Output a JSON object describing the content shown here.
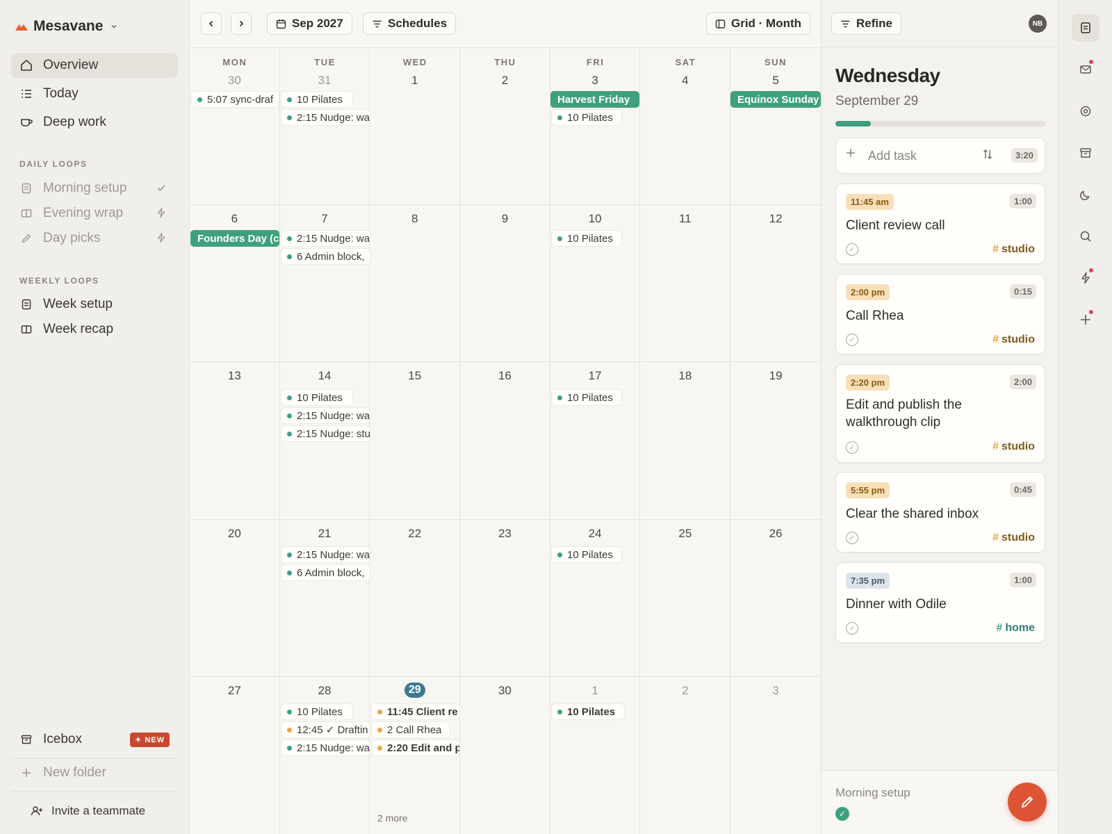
{
  "workspace": {
    "name": "Mesavane"
  },
  "nav": [
    {
      "label": "Overview"
    },
    {
      "label": "Today"
    },
    {
      "label": "Deep work"
    }
  ],
  "daily_loops": {
    "heading": "DAILY LOOPS",
    "items": [
      {
        "label": "Morning setup"
      },
      {
        "label": "Evening wrap"
      },
      {
        "label": "Day picks"
      }
    ]
  },
  "weekly_loops": {
    "heading": "WEEKLY LOOPS",
    "items": [
      {
        "label": "Week setup"
      },
      {
        "label": "Week recap"
      }
    ]
  },
  "icebox": {
    "label": "Icebox",
    "badge": "✦ NEW"
  },
  "new_folder": "New folder",
  "invite": "Invite a teammate",
  "toolbar": {
    "month": "Sep 2027",
    "schedules": "Schedules",
    "view": "Grid · Month"
  },
  "calendar": {
    "weekdays": [
      "MON",
      "TUE",
      "WED",
      "THU",
      "FRI",
      "SAT",
      "SUN"
    ],
    "weeks": [
      [
        "30",
        "31",
        "1",
        "2",
        "3",
        "4",
        "5"
      ],
      [
        "6",
        "7",
        "8",
        "9",
        "10",
        "11",
        "12"
      ],
      [
        "13",
        "14",
        "15",
        "16",
        "17",
        "18",
        "19"
      ],
      [
        "20",
        "21",
        "22",
        "23",
        "24",
        "25",
        "26"
      ],
      [
        "27",
        "28",
        "29",
        "30",
        "1",
        "2",
        "3"
      ]
    ],
    "events": {
      "w0_mon_1": "5:07 sync-draf",
      "w0_tue_1": "10 Pilates",
      "w0_tue_2": "2:15 Nudge: wa",
      "w0_fri_hol": "Harvest Friday",
      "w0_fri_1": "10 Pilates",
      "w0_sun_hol": "Equinox Sunday",
      "w1_mon_hol": "Founders Day (c",
      "w1_tue_1": "2:15 Nudge: wa",
      "w1_tue_2": "6 Admin block,",
      "w1_fri_1": "10 Pilates",
      "w2_tue_1": "10 Pilates",
      "w2_tue_2": "2:15 Nudge: wa",
      "w2_tue_3": "2:15 Nudge: stu",
      "w2_fri_1": "10 Pilates",
      "w3_tue_1": "2:15 Nudge: wa",
      "w3_tue_2": "6 Admin block,",
      "w3_fri_1": "10 Pilates",
      "w4_tue_1": "10 Pilates",
      "w4_tue_2": "12:45 ✓ Draftin",
      "w4_tue_3": "2:15 Nudge: wa",
      "w4_wed_1": "11:45 Client re",
      "w4_wed_2": "2 Call Rhea",
      "w4_wed_3": "2:20 Edit and p",
      "w4_wed_more": "2 more",
      "w4_fri_1": "10 Pilates"
    }
  },
  "refine": "Refine",
  "avatar": "NB",
  "day_panel": {
    "title": "Wednesday",
    "date": "September 29",
    "progress_fraction": 0.17,
    "add_task": "Add task",
    "total": "3:20",
    "tasks": [
      {
        "time": "11:45 am",
        "duration": "1:00",
        "title": "Client review call",
        "tag": "studio"
      },
      {
        "time": "2:00 pm",
        "duration": "0:15",
        "title": "Call Rhea",
        "tag": "studio"
      },
      {
        "time": "2:20 pm",
        "duration": "2:00",
        "title": "Edit and publish the walkthrough clip",
        "tag": "studio"
      },
      {
        "time": "5:55 pm",
        "duration": "0:45",
        "title": "Clear the shared inbox",
        "tag": "studio"
      },
      {
        "time": "7:35 pm",
        "duration": "1:00",
        "title": "Dinner with Odile",
        "tag": "home"
      }
    ],
    "footer_label": "Morning setup"
  },
  "icons": {
    "rail": [
      "notes-icon",
      "mail-icon",
      "target-icon",
      "archive-icon",
      "moon-icon",
      "search-icon",
      "bolt-icon",
      "plus-icon"
    ]
  }
}
